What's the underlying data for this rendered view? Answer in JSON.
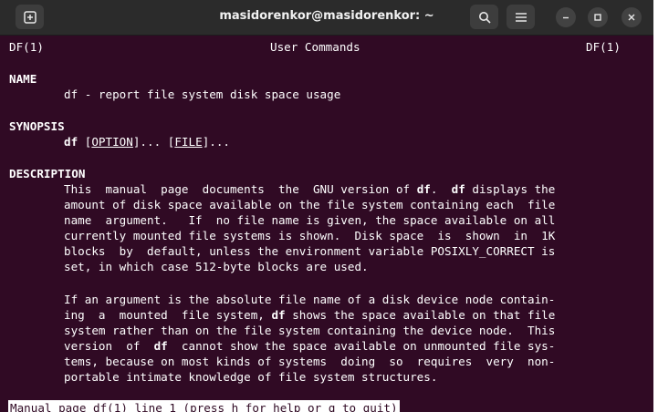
{
  "window": {
    "title": "masidorenkor@masidorenkor: ~",
    "background": "#300a24",
    "icons": {
      "new_tab": "new-tab-icon",
      "search": "search-icon",
      "menu": "hamburger-menu-icon",
      "minimize": "minimize-icon",
      "maximize": "maximize-icon",
      "close": "close-icon"
    }
  },
  "man": {
    "header_left": "DF(1)",
    "header_center": "User Commands",
    "header_right": "DF(1)",
    "name_heading": "NAME",
    "name_text": "df - report file system disk space usage",
    "synopsis_heading": "SYNOPSIS",
    "synopsis": {
      "cmd": "df",
      "sep1": " [",
      "option": "OPTION",
      "sep2": "]... [",
      "file": "FILE",
      "sep3": "]..."
    },
    "description_heading": "DESCRIPTION",
    "p1": {
      "l1a": "This  manual  page  documents  the  GNU version of ",
      "l1b": "df",
      "l1c": ".  ",
      "l1d": "df",
      "l1e": " displays the",
      "l2": "amount of disk space available on the file system containing each  file",
      "l3": "name  argument.   If  no file name is given, the space available on all",
      "l4": "currently mounted file systems is shown.  Disk space  is  shown  in  1K",
      "l5": "blocks  by  default, unless the environment variable POSIXLY_CORRECT is",
      "l6": "set, in which case 512-byte blocks are used."
    },
    "p2": {
      "l1": "If an argument is the absolute file name of a disk device node contain-",
      "l2a": "ing  a  mounted  file system, ",
      "l2b": "df",
      "l2c": " shows the space available on that file",
      "l3": "system rather than on the file system containing the device node.  This",
      "l4a": "version  of  ",
      "l4b": "df",
      "l4c": "  cannot show the space available on unmounted file sys-",
      "l5": "tems, because on most kinds of systems  doing  so  requires  very  non-",
      "l6": "portable intimate knowledge of file system structures."
    },
    "status_line": "Manual page df(1) line 1 (press h for help or q to quit)"
  }
}
